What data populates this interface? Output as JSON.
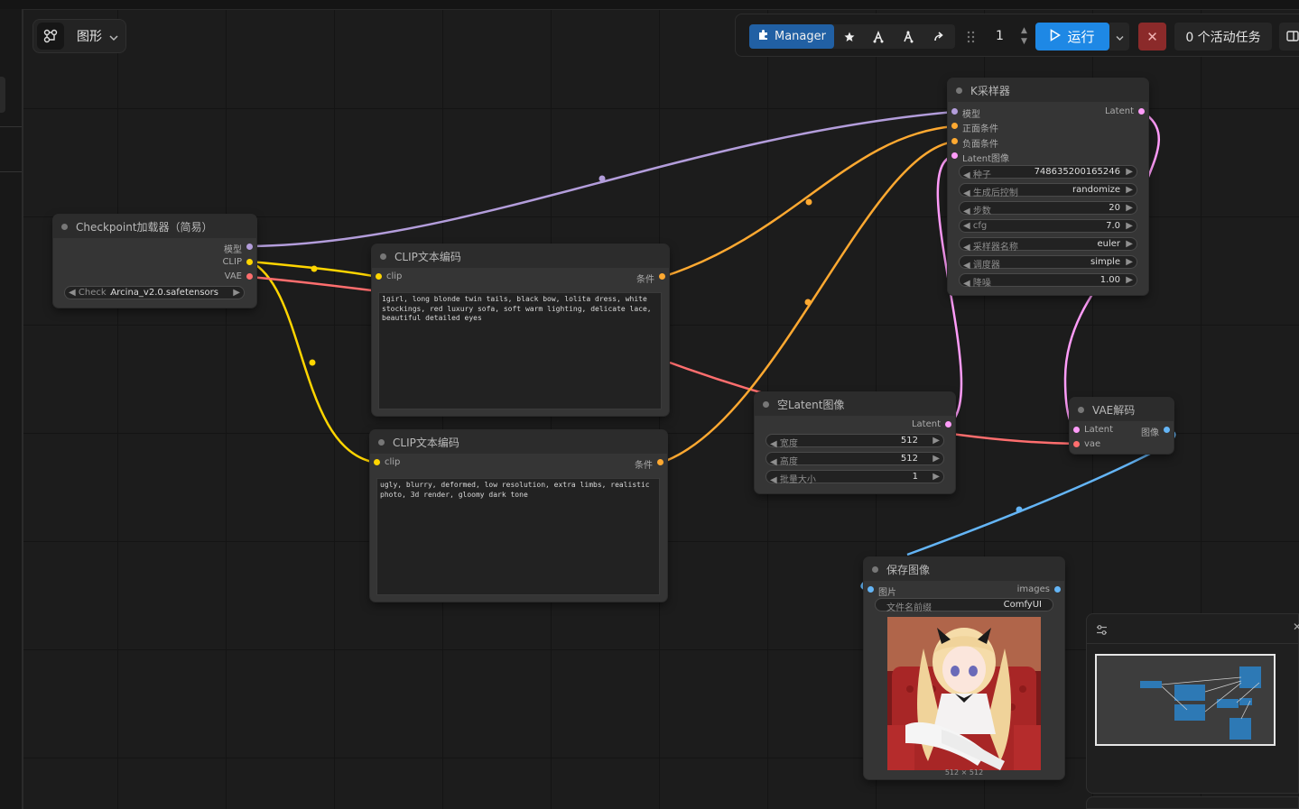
{
  "graph_menu": {
    "label": "图形",
    "icon": "graph-nodes-icon"
  },
  "toolbar": {
    "manager_label": "Manager",
    "queue_count": "1",
    "run_label": "运行",
    "stop_label": "✕",
    "active_tasks": "0 个活动任务",
    "accent": "#1e88e5"
  },
  "nodes": {
    "checkpoint": {
      "title": "Checkpoint加载器（简易）",
      "outputs": [
        "模型",
        "CLIP",
        "VAE"
      ],
      "ckpt_label": "Check ...",
      "ckpt_value": "Arcina_v2.0.safetensors"
    },
    "clip_pos": {
      "title": "CLIP文本编码",
      "input": "clip",
      "output": "条件",
      "text": "1girl, long blonde twin tails, black bow, lolita dress, white stockings, red luxury sofa, soft warm lighting, delicate lace, beautiful detailed eyes"
    },
    "clip_neg": {
      "title": "CLIP文本编码",
      "input": "clip",
      "output": "条件",
      "text": "ugly, blurry, deformed, low resolution, extra limbs, realistic photo, 3d render, gloomy dark tone"
    },
    "ksampler": {
      "title": "K采样器",
      "inputs": [
        "模型",
        "正面条件",
        "负面条件",
        "Latent图像"
      ],
      "output": "Latent",
      "widgets": [
        {
          "label": "种子",
          "value": "748635200165246"
        },
        {
          "label": "生成后控制",
          "value": "randomize"
        },
        {
          "label": "步数",
          "value": "20"
        },
        {
          "label": "cfg",
          "value": "7.0"
        },
        {
          "label": "采样器名称",
          "value": "euler"
        },
        {
          "label": "调度器",
          "value": "simple"
        },
        {
          "label": "降噪",
          "value": "1.00"
        }
      ]
    },
    "empty_latent": {
      "title": "空Latent图像",
      "output": "Latent",
      "widgets": [
        {
          "label": "宽度",
          "value": "512"
        },
        {
          "label": "高度",
          "value": "512"
        },
        {
          "label": "批量大小",
          "value": "1"
        }
      ]
    },
    "vae_decode": {
      "title": "VAE解码",
      "inputs": [
        "Latent",
        "vae"
      ],
      "output": "图像"
    },
    "save_image": {
      "title": "保存图像",
      "input": "图片",
      "output": "images",
      "prefix_label": "文件名前缀",
      "prefix_value": "ComfyUI",
      "image_size": "512 × 512"
    }
  },
  "colors": {
    "model": "#b39ddb",
    "clip": "#ffd500",
    "vae": "#ff6e6e",
    "conditioning": "#ffa931",
    "latent": "#ff9cf9",
    "image": "#64b5f6"
  }
}
